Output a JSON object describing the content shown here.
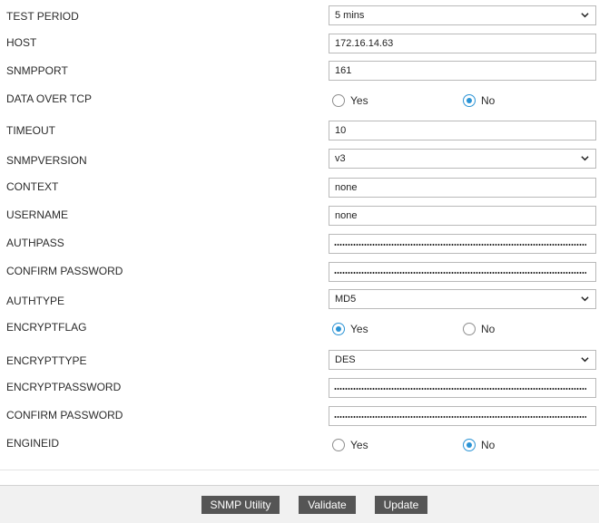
{
  "form": {
    "test_period": {
      "label": "TEST PERIOD",
      "value": "5 mins"
    },
    "host": {
      "label": "HOST",
      "value": "172.16.14.63"
    },
    "snmpport": {
      "label": "SNMPPORT",
      "value": "161"
    },
    "data_over_tcp": {
      "label": "DATA OVER TCP",
      "yes": "Yes",
      "no": "No",
      "selected": "No"
    },
    "timeout": {
      "label": "TIMEOUT",
      "value": "10"
    },
    "snmpversion": {
      "label": "SNMPVERSION",
      "value": "v3"
    },
    "context": {
      "label": "CONTEXT",
      "value": "none"
    },
    "username": {
      "label": "USERNAME",
      "value": "none"
    },
    "authpass": {
      "label": "AUTHPASS"
    },
    "confirm_password_1": {
      "label": "CONFIRM PASSWORD"
    },
    "authtype": {
      "label": "AUTHTYPE",
      "value": "MD5"
    },
    "encryptflag": {
      "label": "ENCRYPTFLAG",
      "yes": "Yes",
      "no": "No",
      "selected": "Yes"
    },
    "encrypttype": {
      "label": "ENCRYPTTYPE",
      "value": "DES"
    },
    "encryptpassword": {
      "label": "ENCRYPTPASSWORD"
    },
    "confirm_password_2": {
      "label": "CONFIRM PASSWORD"
    },
    "engineid": {
      "label": "ENGINEID",
      "yes": "Yes",
      "no": "No",
      "selected": "No"
    }
  },
  "footer": {
    "snmp_utility": "SNMP Utility",
    "validate": "Validate",
    "update": "Update"
  },
  "colors": {
    "accent": "#2a93d5",
    "button_bg": "#555555",
    "footer_bg": "#f1f1f1"
  }
}
